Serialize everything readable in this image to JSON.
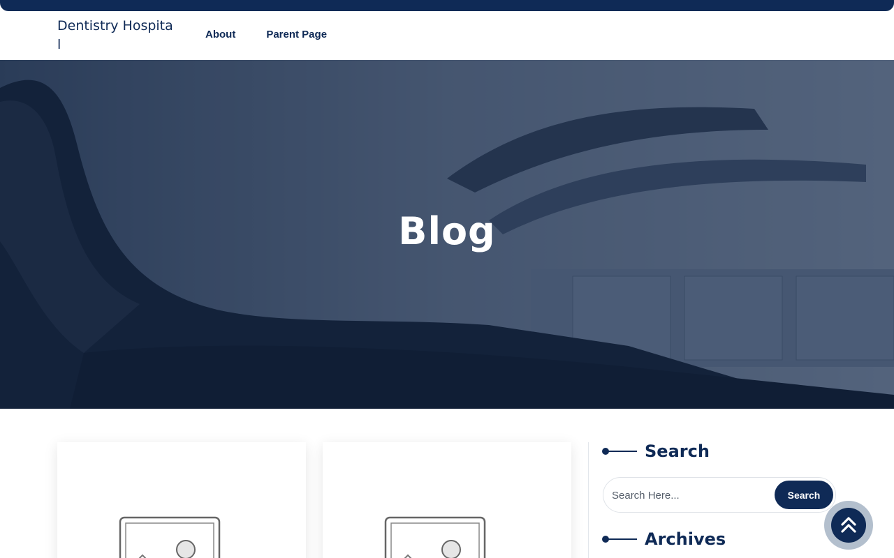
{
  "site": {
    "title": "Dentistry Hospital"
  },
  "nav": {
    "items": [
      {
        "label": "About"
      },
      {
        "label": "Parent Page"
      }
    ]
  },
  "hero": {
    "title": "Blog"
  },
  "sidebar": {
    "search": {
      "title": "Search",
      "placeholder": "Search Here...",
      "button_label": "Search"
    },
    "archives": {
      "title": "Archives"
    }
  },
  "icons": {
    "post_thumbnail": "image-placeholder-icon",
    "scroll_top": "double-chevron-up-icon"
  },
  "colors": {
    "brand": "#0f2a56",
    "scroll_ring": "#b3bfcd"
  }
}
